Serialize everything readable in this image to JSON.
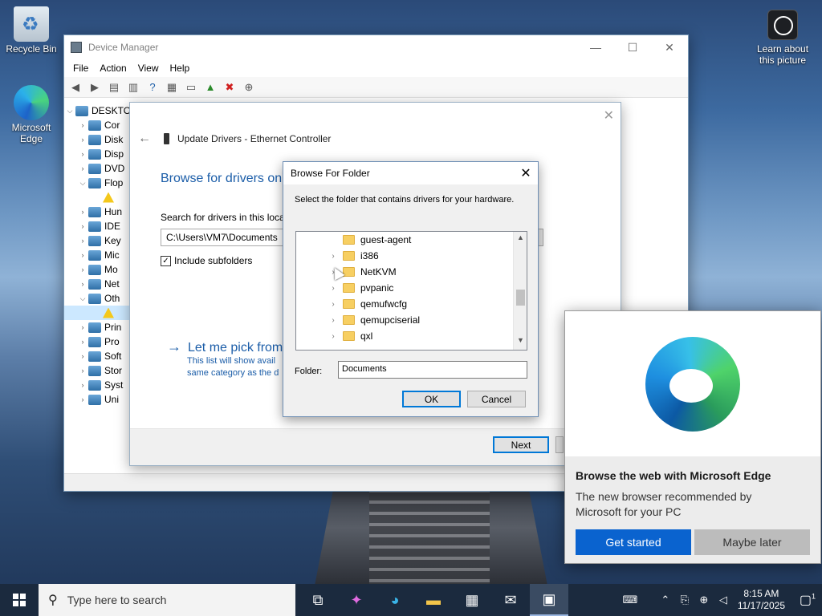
{
  "desktop": {
    "icons": [
      {
        "label": "Recycle Bin",
        "icon": "recycle-bin-icon"
      },
      {
        "label": "Microsoft Edge",
        "icon": "edge-icon"
      },
      {
        "label": "Learn about this picture",
        "icon": "camera-icon"
      }
    ]
  },
  "device_manager": {
    "title": "Device Manager",
    "menu": [
      "File",
      "Action",
      "View",
      "Help"
    ],
    "window_controls": {
      "minimize": "—",
      "maximize": "☐",
      "close": "✕"
    },
    "tree": [
      {
        "toggle": "⌵",
        "label": "DESKTO",
        "icon": "computer-icon"
      },
      {
        "toggle": "›",
        "label": "Cor",
        "icon": "device-icon"
      },
      {
        "toggle": "›",
        "label": "Disk",
        "icon": "device-icon"
      },
      {
        "toggle": "›",
        "label": "Disp",
        "icon": "device-icon"
      },
      {
        "toggle": "›",
        "label": "DVD",
        "icon": "device-icon"
      },
      {
        "toggle": "⌵",
        "label": "Flop",
        "icon": "device-icon"
      },
      {
        "toggle": "",
        "label": "",
        "icon": "warning-icon"
      },
      {
        "toggle": "›",
        "label": "Hun",
        "icon": "device-icon"
      },
      {
        "toggle": "›",
        "label": "IDE",
        "icon": "device-icon"
      },
      {
        "toggle": "›",
        "label": "Key",
        "icon": "device-icon"
      },
      {
        "toggle": "›",
        "label": "Mic",
        "icon": "device-icon"
      },
      {
        "toggle": "›",
        "label": "Mo",
        "icon": "device-icon"
      },
      {
        "toggle": "›",
        "label": "Net",
        "icon": "device-icon"
      },
      {
        "toggle": "⌵",
        "label": "Oth",
        "icon": "device-icon"
      },
      {
        "toggle": "",
        "label": "",
        "icon": "warning-icon"
      },
      {
        "toggle": "›",
        "label": "Prin",
        "icon": "device-icon"
      },
      {
        "toggle": "›",
        "label": "Pro",
        "icon": "device-icon"
      },
      {
        "toggle": "›",
        "label": "Soft",
        "icon": "device-icon"
      },
      {
        "toggle": "›",
        "label": "Stor",
        "icon": "device-icon"
      },
      {
        "toggle": "›",
        "label": "Syst",
        "icon": "device-icon"
      },
      {
        "toggle": "›",
        "label": "Uni",
        "icon": "device-icon"
      }
    ]
  },
  "wizard": {
    "close": "✕",
    "back": "←",
    "header": "Update Drivers - Ethernet Controller",
    "heading": "Browse for drivers on",
    "search_label": "Search for drivers in this loca",
    "path_value": "C:\\Users\\VM7\\Documents",
    "include_subfolders": "Include subfolders",
    "include_checked": "✓",
    "pick_link": "Let me pick from",
    "pick_arrow": "→",
    "pick_desc_1": "This list will show avail",
    "pick_desc_2": "same category as the d",
    "next": "Next"
  },
  "browse_folder": {
    "title": "Browse For Folder",
    "close": "✕",
    "instruction": "Select the folder that contains drivers for your hardware.",
    "folders": [
      {
        "name": "guest-agent",
        "expand": ""
      },
      {
        "name": "i386",
        "expand": "›"
      },
      {
        "name": "NetKVM",
        "expand": "›"
      },
      {
        "name": "pvpanic",
        "expand": "›"
      },
      {
        "name": "qemufwcfg",
        "expand": "›"
      },
      {
        "name": "qemupciserial",
        "expand": "›"
      },
      {
        "name": "qxl",
        "expand": "›"
      }
    ],
    "folder_label": "Folder:",
    "folder_value": "Documents",
    "ok": "OK",
    "cancel": "Cancel",
    "scroll_up": "▲",
    "scroll_down": "▼"
  },
  "edge_toast": {
    "title": "Browse the web with Microsoft Edge",
    "body": "The new browser recommended by Microsoft for your PC",
    "primary": "Get started",
    "secondary": "Maybe later"
  },
  "taskbar": {
    "search_placeholder": "Type here to search",
    "search_icon": "⚲",
    "apps": [
      {
        "name": "task-view-icon",
        "glyph": "⧉"
      },
      {
        "name": "copilot-icon",
        "glyph": "✦"
      },
      {
        "name": "edge-taskbar-icon",
        "glyph": "◕"
      },
      {
        "name": "file-explorer-icon",
        "glyph": "▬"
      },
      {
        "name": "store-icon",
        "glyph": "▦"
      },
      {
        "name": "mail-icon",
        "glyph": "✉"
      },
      {
        "name": "device-manager-taskbar-icon",
        "glyph": "▣"
      }
    ],
    "time": "8:15 AM",
    "date": "11/17/2025",
    "notification_count": "1"
  }
}
